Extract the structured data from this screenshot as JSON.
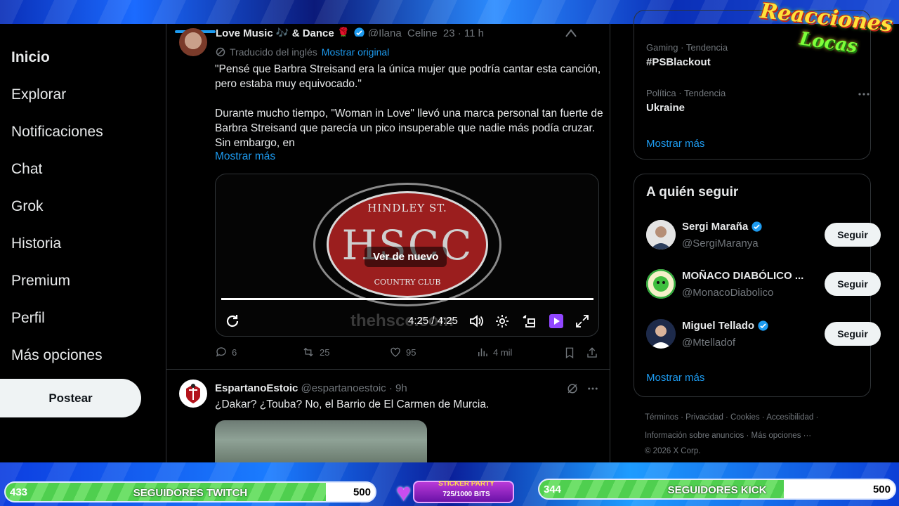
{
  "overlay": {
    "logo_line1": "Reacciones",
    "logo_line2": "Locas"
  },
  "nav": {
    "items": [
      {
        "label": "Inicio",
        "active": true
      },
      {
        "label": "Explorar"
      },
      {
        "label": "Notificaciones"
      },
      {
        "label": "Chat"
      },
      {
        "label": "Grok"
      },
      {
        "label": "Historia"
      },
      {
        "label": "Premium"
      },
      {
        "label": "Perfil"
      },
      {
        "label": "Más opciones"
      }
    ],
    "post_label": "Postear"
  },
  "tweet1": {
    "name": "Love Music 🎶 & Dance 🌹",
    "handle": "@Ilana_Celine_23 · 11 h",
    "translated_label": "Traducido del inglés",
    "show_original": "Mostrar original",
    "text": "\"Pensé que Barbra Streisand era la única mujer que podría cantar esta canción, pero estaba muy equivocado.\"\n\nDurante mucho tiempo, \"Woman in Love\" llevó una marca personal tan fuerte de Barbra Streisand que parecía un pico insuperable que nadie más podía cruzar. Sin embargo, en",
    "show_more": "Mostrar más",
    "video": {
      "logo_top": "HINDLEY ST.",
      "logo_main": "HSCC",
      "logo_bottom": "COUNTRY CLUB",
      "replay_label": "Ver de nuevo",
      "watermark": "thehscc.com",
      "time": "4:25 / 4:25",
      "progress": 1.0
    },
    "replies": "6",
    "reposts": "25",
    "likes": "95",
    "views": "4 mil"
  },
  "tweet2": {
    "name": "EspartanoEstoic",
    "handle": "@espartanoestoic · 9h",
    "text": "¿Dakar? ¿Touba? No, el Barrio de El Carmen de Murcia."
  },
  "trends": [
    {
      "meta": "Gaming · Tendencia",
      "name": "#PSBlackout"
    },
    {
      "meta": "Política · Tendencia",
      "name": "Ukraine"
    }
  ],
  "trends_more": "Mostrar más",
  "who_to_follow": {
    "title": "A quién seguir",
    "users": [
      {
        "name": "Sergi Maraña",
        "handle": "@SergiMaranya",
        "verified": true,
        "button": "Seguir"
      },
      {
        "name": "MOÑACO DIABÓLICO ...",
        "handle": "@MonacoDiabolico",
        "verified": false,
        "button": "Seguir"
      },
      {
        "name": "Miguel Tellado",
        "handle": "@Mtelladof",
        "verified": true,
        "button": "Seguir"
      }
    ],
    "more": "Mostrar más"
  },
  "footer": {
    "line1": "Términos  ·  Privacidad  ·  Cookies  ·  Accesibilidad  ·",
    "line2": "Información sobre anuncios  ·  Más opciones ···",
    "line3": "© 2026 X Corp."
  },
  "goals": {
    "twitch": {
      "current": "433",
      "title": "SEGUIDORES TWITCH",
      "target": "500",
      "progress": 0.866
    },
    "kick": {
      "current": "344",
      "title": "SEGUIDORES KICK",
      "target": "500",
      "progress": 0.688
    },
    "sticker_title": "STICKER PARTY",
    "sticker_sub": "725/1000 BITS"
  },
  "colors": {
    "accent": "#1d9bf0",
    "background": "#000000",
    "goal_green": "#5fd85a"
  }
}
